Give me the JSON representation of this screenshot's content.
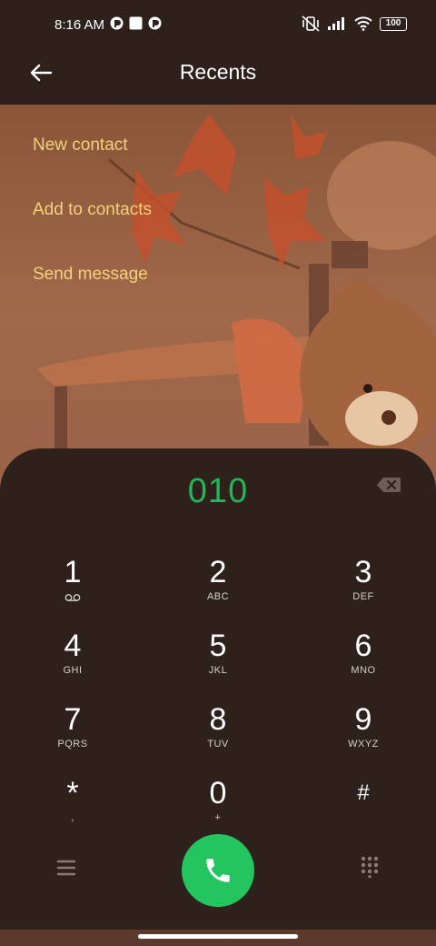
{
  "status_bar": {
    "time": "8:16 AM",
    "battery": "100"
  },
  "header": {
    "title": "Recents"
  },
  "menu": {
    "items": [
      {
        "label": "New contact"
      },
      {
        "label": "Add to contacts"
      },
      {
        "label": "Send message"
      }
    ]
  },
  "dialer": {
    "number": "010",
    "keys": [
      {
        "digit": "1",
        "letters": ""
      },
      {
        "digit": "2",
        "letters": "ABC"
      },
      {
        "digit": "3",
        "letters": "DEF"
      },
      {
        "digit": "4",
        "letters": "GHI"
      },
      {
        "digit": "5",
        "letters": "JKL"
      },
      {
        "digit": "6",
        "letters": "MNO"
      },
      {
        "digit": "7",
        "letters": "PQRS"
      },
      {
        "digit": "8",
        "letters": "TUV"
      },
      {
        "digit": "9",
        "letters": "WXYZ"
      },
      {
        "digit": "*",
        "letters": ","
      },
      {
        "digit": "0",
        "letters": "+"
      },
      {
        "digit": "#",
        "letters": ""
      }
    ]
  },
  "icons": {
    "back": "back-arrow-icon",
    "backspace": "backspace-icon",
    "voicemail": "voicemail-icon",
    "call": "phone-icon",
    "menu": "menu-icon",
    "dialpad": "dialpad-icon"
  },
  "colors": {
    "accent_green": "#22c55e",
    "number_green": "#20b755",
    "menu_text": "#f2d37c",
    "sheet_bg": "#2e211c"
  }
}
